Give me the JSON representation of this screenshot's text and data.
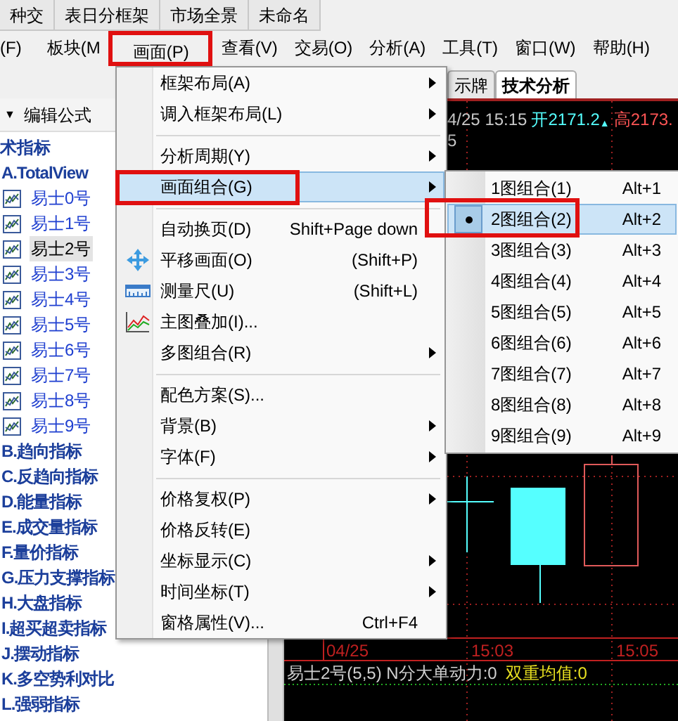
{
  "top_tabs": [
    {
      "label": "种交"
    },
    {
      "label": "表日分框架"
    },
    {
      "label": "市场全景"
    },
    {
      "label": "未命名"
    }
  ],
  "menubar": [
    {
      "label": "(F)",
      "annotated": false
    },
    {
      "label": "板块(M",
      "annotated": false
    },
    {
      "label": "画面(P)",
      "annotated": true
    },
    {
      "label": "查看(V)",
      "annotated": false
    },
    {
      "label": "交易(O)",
      "annotated": false
    },
    {
      "label": "分析(A)",
      "annotated": false
    },
    {
      "label": "工具(T)",
      "annotated": false
    },
    {
      "label": "窗口(W)",
      "annotated": false
    },
    {
      "label": "帮助(H)",
      "annotated": false
    }
  ],
  "formula_panel": {
    "toggle": "▼",
    "header": "编辑公式",
    "tree": {
      "label": "术指标",
      "children": [
        {
          "label": "A.TotalView",
          "children": [
            {
              "label": "易士0号",
              "selected": false
            },
            {
              "label": "易士1号",
              "selected": false
            },
            {
              "label": "易士2号",
              "selected": true
            },
            {
              "label": "易士3号",
              "selected": false
            },
            {
              "label": "易士4号",
              "selected": false
            },
            {
              "label": "易士5号",
              "selected": false
            },
            {
              "label": "易士6号",
              "selected": false
            },
            {
              "label": "易士7号",
              "selected": false
            },
            {
              "label": "易士8号",
              "selected": false
            },
            {
              "label": "易士9号",
              "selected": false
            }
          ]
        },
        {
          "label": "B.趋向指标"
        },
        {
          "label": "C.反趋向指标"
        },
        {
          "label": "D.能量指标"
        },
        {
          "label": "E.成交量指标"
        },
        {
          "label": "F.量价指标"
        },
        {
          "label": "G.压力支撑指标"
        },
        {
          "label": "H.大盘指标"
        },
        {
          "label": "I.超买超卖指标"
        },
        {
          "label": "J.摆动指标"
        },
        {
          "label": "K.多空势利对比"
        },
        {
          "label": "L.强弱指标"
        }
      ]
    }
  },
  "chart_tabs": [
    {
      "label": "示牌",
      "selected": false
    },
    {
      "label": "技术分析",
      "selected": true
    }
  ],
  "chart": {
    "time": "4/25 15:15",
    "open": "开2171.2",
    "up_mark": "▲",
    "high": "高2173.",
    "line2": "5",
    "axis_labels": [
      "04/25",
      "15:03",
      "15:05"
    ],
    "indicator": "易士2号(5,5) N分大单动力:0",
    "indicator_value": "双重均值:0"
  },
  "menu": [
    {
      "kind": "item",
      "label": "框架布局(A)",
      "submenu": true
    },
    {
      "kind": "item",
      "label": "调入框架布局(L)",
      "submenu": true
    },
    {
      "kind": "separator"
    },
    {
      "kind": "item",
      "label": "分析周期(Y)",
      "submenu": true
    },
    {
      "kind": "item",
      "label": "画面组合(G)",
      "submenu": true,
      "selected": true,
      "annotated": true
    },
    {
      "kind": "separator"
    },
    {
      "kind": "item",
      "label": "自动换页(D)",
      "shortcut": "Shift+Page down"
    },
    {
      "kind": "item",
      "label": "平移画面(O)",
      "shortcut": "(Shift+P)"
    },
    {
      "kind": "item",
      "label": "测量尺(U)",
      "shortcut": "(Shift+L)"
    },
    {
      "kind": "item",
      "label": "主图叠加(I)..."
    },
    {
      "kind": "item",
      "label": "多图组合(R)",
      "submenu": true
    },
    {
      "kind": "separator"
    },
    {
      "kind": "item",
      "label": "配色方案(S)..."
    },
    {
      "kind": "item",
      "label": "背景(B)",
      "submenu": true
    },
    {
      "kind": "item",
      "label": "字体(F)",
      "submenu": true
    },
    {
      "kind": "separator"
    },
    {
      "kind": "item",
      "label": "价格复权(P)",
      "submenu": true
    },
    {
      "kind": "item",
      "label": "价格反转(E)"
    },
    {
      "kind": "item",
      "label": "坐标显示(C)",
      "submenu": true
    },
    {
      "kind": "item",
      "label": "时间坐标(T)",
      "submenu": true
    },
    {
      "kind": "item",
      "label": "窗格属性(V)...",
      "shortcut": "Ctrl+F4"
    }
  ],
  "submenu": [
    {
      "label": "1图组合(1)",
      "shortcut": "Alt+1",
      "selected": false
    },
    {
      "label": "2图组合(2)",
      "shortcut": "Alt+2",
      "selected": true,
      "annotated": true
    },
    {
      "label": "3图组合(3)",
      "shortcut": "Alt+3",
      "selected": false
    },
    {
      "label": "4图组合(4)",
      "shortcut": "Alt+4",
      "selected": false
    },
    {
      "label": "5图组合(5)",
      "shortcut": "Alt+5",
      "selected": false
    },
    {
      "label": "6图组合(6)",
      "shortcut": "Alt+6",
      "selected": false
    },
    {
      "label": "7图组合(7)",
      "shortcut": "Alt+7",
      "selected": false
    },
    {
      "label": "8图组合(8)",
      "shortcut": "Alt+8",
      "selected": false
    },
    {
      "label": "9图组合(9)",
      "shortcut": "Alt+9",
      "selected": false
    }
  ]
}
